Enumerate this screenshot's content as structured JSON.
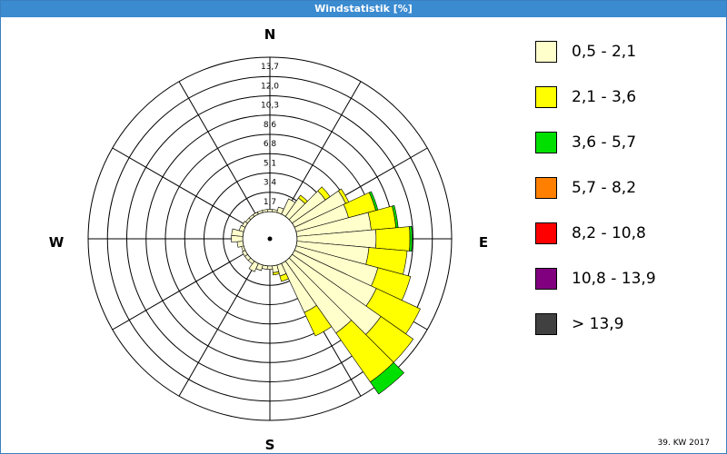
{
  "window": {
    "title": "Windstatistik [%]"
  },
  "footer": {
    "label": "39. KW 2017"
  },
  "chart_data": {
    "type": "polar-stacked-bar",
    "directions_deg": [
      0,
      10,
      20,
      30,
      40,
      50,
      60,
      70,
      80,
      90,
      100,
      110,
      120,
      130,
      140,
      150,
      160,
      170,
      180,
      190,
      200,
      210,
      220,
      230,
      240,
      250,
      260,
      270,
      280,
      290,
      300,
      310,
      320,
      330,
      340,
      350
    ],
    "compass": {
      "n": "N",
      "e": "E",
      "s": "S",
      "w": "W"
    },
    "ring_labels": [
      "1,7",
      "3,4",
      "5,1",
      "6,8",
      "8,6",
      "10,3",
      "12,0",
      "13,7"
    ],
    "rmax": 13.7,
    "bins": [
      {
        "label": "0,5 - 2,1",
        "color": "#ffffcc"
      },
      {
        "label": "2,1 - 3,6",
        "color": "#ffff00"
      },
      {
        "label": "3,6 - 5,7",
        "color": "#00e000"
      },
      {
        "label": "5,7 - 8,2",
        "color": "#ff8000"
      },
      {
        "label": "8,2 - 10,8",
        "color": "#ff0000"
      },
      {
        "label": "10,8 - 13,9",
        "color": "#800080"
      },
      {
        "label": "> 13,9",
        "color": "#404040"
      }
    ],
    "series": [
      {
        "values": [
          0.2,
          0.2,
          0.5,
          1.5,
          2.0,
          3.6,
          5.0,
          4.8,
          6.6,
          7.0,
          6.4,
          7.5,
          8.0,
          9.6,
          7.8,
          4.8,
          1.0,
          0.6,
          0.3,
          0.3,
          0.5,
          0.8,
          0.3,
          0.3,
          0.3,
          0.2,
          0.5,
          1.0,
          1.0,
          0.4,
          0.3,
          0.2,
          0.2,
          0.2,
          0.2,
          0.2
        ]
      },
      {
        "values": [
          0.0,
          0.0,
          0.0,
          0.0,
          0.3,
          0.5,
          0.3,
          2.5,
          2.2,
          3.0,
          3.4,
          3.0,
          4.3,
          3.5,
          5.3,
          2.3,
          0.5,
          0.2,
          0.0,
          0.0,
          0.0,
          0.0,
          0.0,
          0.0,
          0.0,
          0.0,
          0.0,
          0.0,
          0.0,
          0.0,
          0.0,
          0.0,
          0.0,
          0.0,
          0.0,
          0.0
        ]
      },
      {
        "values": [
          0.0,
          0.0,
          0.0,
          0.0,
          0.0,
          0.0,
          0.0,
          0.2,
          0.2,
          0.2,
          0.0,
          0.0,
          0.0,
          0.0,
          1.3,
          0.0,
          0.0,
          0.0,
          0.0,
          0.0,
          0.0,
          0.0,
          0.0,
          0.0,
          0.0,
          0.0,
          0.0,
          0.0,
          0.0,
          0.0,
          0.0,
          0.0,
          0.0,
          0.0,
          0.0,
          0.0
        ]
      },
      {
        "values": [
          0,
          0,
          0,
          0,
          0,
          0,
          0,
          0,
          0,
          0,
          0,
          0,
          0,
          0,
          0,
          0,
          0,
          0,
          0,
          0,
          0,
          0,
          0,
          0,
          0,
          0,
          0,
          0,
          0,
          0,
          0,
          0,
          0,
          0,
          0,
          0
        ]
      },
      {
        "values": [
          0,
          0,
          0,
          0,
          0,
          0,
          0,
          0,
          0,
          0,
          0,
          0,
          0,
          0,
          0,
          0,
          0,
          0,
          0,
          0,
          0,
          0,
          0,
          0,
          0,
          0,
          0,
          0,
          0,
          0,
          0,
          0,
          0,
          0,
          0,
          0
        ]
      },
      {
        "values": [
          0,
          0,
          0,
          0,
          0,
          0,
          0,
          0,
          0,
          0,
          0,
          0,
          0,
          0,
          0,
          0,
          0,
          0,
          0,
          0,
          0,
          0,
          0,
          0,
          0,
          0,
          0,
          0,
          0,
          0,
          0,
          0,
          0,
          0,
          0,
          0
        ]
      },
      {
        "values": [
          0,
          0,
          0,
          0,
          0,
          0,
          0,
          0,
          0,
          0,
          0,
          0,
          0,
          0,
          0,
          0,
          0,
          0,
          0,
          0,
          0,
          0,
          0,
          0,
          0,
          0,
          0,
          0,
          0,
          0,
          0,
          0,
          0,
          0,
          0,
          0
        ]
      }
    ]
  }
}
